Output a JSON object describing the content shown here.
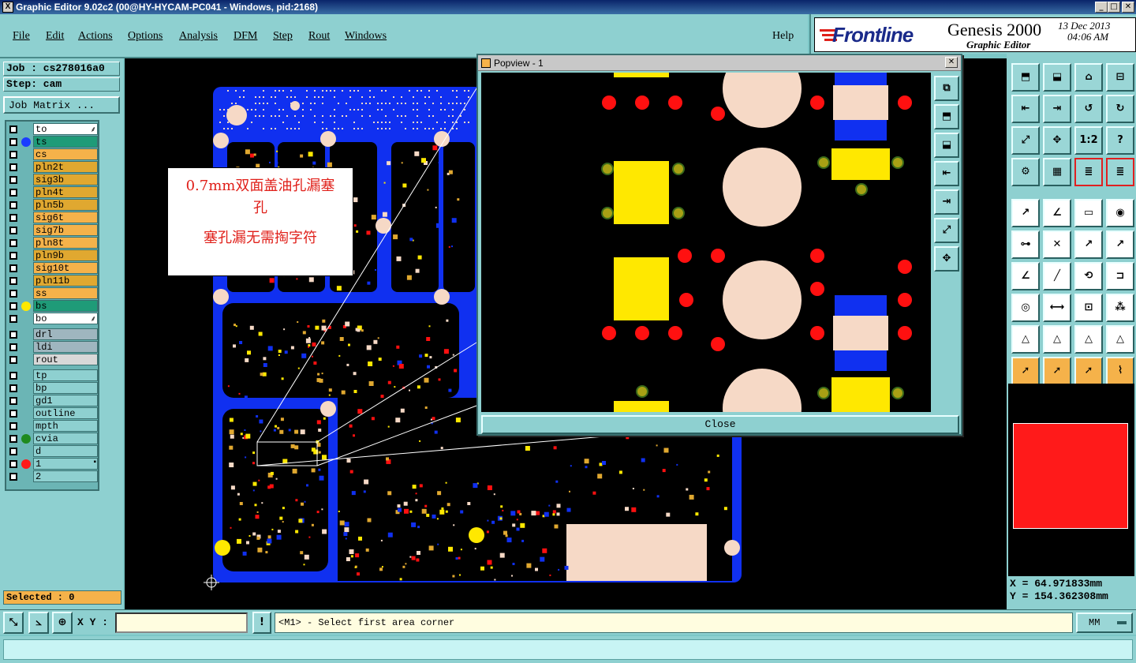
{
  "window": {
    "title": "Graphic Editor 9.02c2 (00@HY-HYCAM-PC041 - Windows, pid:2168)",
    "min": "_",
    "max": "□",
    "close": "✕"
  },
  "menu": [
    "File",
    "Edit",
    "Actions",
    "Options",
    "Analysis",
    "DFM",
    "Step",
    "Rout",
    "Windows"
  ],
  "help": "Help",
  "brand": {
    "logo": "Frontline",
    "product": "Genesis 2000",
    "subtitle": "Graphic Editor",
    "date": "13 Dec 2013",
    "time": "04:06 AM"
  },
  "job": {
    "job_label": "Job : cs278016a0",
    "step_label": "Step: cam",
    "matrix_button": "Job Matrix ..."
  },
  "layers": [
    {
      "name": "to",
      "bg": "#ffffff",
      "dot": "",
      "mark": "⸙"
    },
    {
      "name": "ts",
      "bg": "#1f9b78",
      "dot": "#1a3cff",
      "mark": ""
    },
    {
      "name": "cs",
      "bg": "#f5b24a",
      "dot": "",
      "mark": ""
    },
    {
      "name": "pln2t",
      "bg": "#e0a830",
      "dot": "",
      "mark": ""
    },
    {
      "name": "sig3b",
      "bg": "#e0a830",
      "dot": "",
      "mark": ""
    },
    {
      "name": "pln4t",
      "bg": "#e0a830",
      "dot": "",
      "mark": ""
    },
    {
      "name": "pln5b",
      "bg": "#e0a830",
      "dot": "",
      "mark": ""
    },
    {
      "name": "sig6t",
      "bg": "#f5b24a",
      "dot": "",
      "mark": ""
    },
    {
      "name": "sig7b",
      "bg": "#f5b24a",
      "dot": "",
      "mark": ""
    },
    {
      "name": "pln8t",
      "bg": "#f5b24a",
      "dot": "",
      "mark": ""
    },
    {
      "name": "pln9b",
      "bg": "#e0a830",
      "dot": "",
      "mark": ""
    },
    {
      "name": "sig10t",
      "bg": "#f5b24a",
      "dot": "",
      "mark": ""
    },
    {
      "name": "pln11b",
      "bg": "#e0a830",
      "dot": "",
      "mark": ""
    },
    {
      "name": "ss",
      "bg": "#f5b24a",
      "dot": "",
      "mark": ""
    },
    {
      "name": "bs",
      "bg": "#1f9b78",
      "dot": "#ffe800",
      "mark": ""
    },
    {
      "name": "bo",
      "bg": "#ffffff",
      "dot": "",
      "mark": "⸙"
    },
    {
      "name": "drl",
      "bg": "#9fb6bf",
      "dot": "",
      "mark": ""
    },
    {
      "name": "ldi",
      "bg": "#9fb6bf",
      "dot": "",
      "mark": ""
    },
    {
      "name": "rout",
      "bg": "#d8d8d8",
      "dot": "",
      "mark": ""
    },
    {
      "name": "tp",
      "bg": "#8ed0d0",
      "dot": "",
      "mark": ""
    },
    {
      "name": "bp",
      "bg": "#8ed0d0",
      "dot": "",
      "mark": ""
    },
    {
      "name": "gd1",
      "bg": "#8ed0d0",
      "dot": "",
      "mark": ""
    },
    {
      "name": "outline",
      "bg": "#8ed0d0",
      "dot": "",
      "mark": ""
    },
    {
      "name": "mpth",
      "bg": "#8ed0d0",
      "dot": "",
      "mark": ""
    },
    {
      "name": "cvia",
      "bg": "#8ed0d0",
      "dot": "#1f8a1f",
      "mark": ""
    },
    {
      "name": "d",
      "bg": "#8ed0d0",
      "dot": "",
      "mark": ""
    },
    {
      "name": "1",
      "bg": "#8ed0d0",
      "dot": "#ff1a1a",
      "mark": "▪"
    },
    {
      "name": "2",
      "bg": "#8ed0d0",
      "dot": "",
      "mark": ""
    }
  ],
  "selected": "Selected : 0",
  "annotation": {
    "line1": "0.7mm双面盖油孔漏塞",
    "line2": "孔",
    "line3": "塞孔漏无需掏字符"
  },
  "popup": {
    "title": "Popview - 1",
    "close_button": "Close",
    "close_x": "✕"
  },
  "coords": {
    "x": "X = 64.971833mm",
    "y": "Y = 154.362308mm"
  },
  "status": {
    "xy_label": "X Y :",
    "xy_value": "",
    "warn": "!",
    "prompt": "<M1> - Select first area corner",
    "units": "MM"
  },
  "icons_right": [
    "view-top-icon",
    "view-bottom-icon",
    "home-icon",
    "window-split-icon",
    "pan-left-icon",
    "pan-right-icon",
    "undo-view-icon",
    "redo-view-icon",
    "zoom-fit-icon",
    "zoom-center-icon",
    "one-to-one-icon",
    "help-query-icon",
    "measure-icon",
    "grid-icon",
    "layer-stack-icon",
    "layer-stack-active-icon",
    "cursor-snap-icon",
    "angle-icon",
    "ruler-icon",
    "pad-select-icon",
    "node-icon",
    "cross-snap-icon",
    "line-snap-icon",
    "line-snap2-icon",
    "arc-angle-icon",
    "draw-line-icon",
    "rotate-icon",
    "edge-icon",
    "feature-icon",
    "midpoint-icon",
    "distance-icon",
    "group-icon",
    "triangle-edit-icon",
    "triangle-edit2-icon",
    "triangle-edit3-icon",
    "triangle-edit4-icon",
    "pointer-icon",
    "pointer-box-icon",
    "pointer-box2-icon",
    "path-icon"
  ],
  "icons_popup": [
    "pv-copy-icon",
    "pv-top-icon",
    "pv-bottom-icon",
    "pv-left-icon",
    "pv-right-icon",
    "pv-fit-icon",
    "pv-center-icon"
  ]
}
